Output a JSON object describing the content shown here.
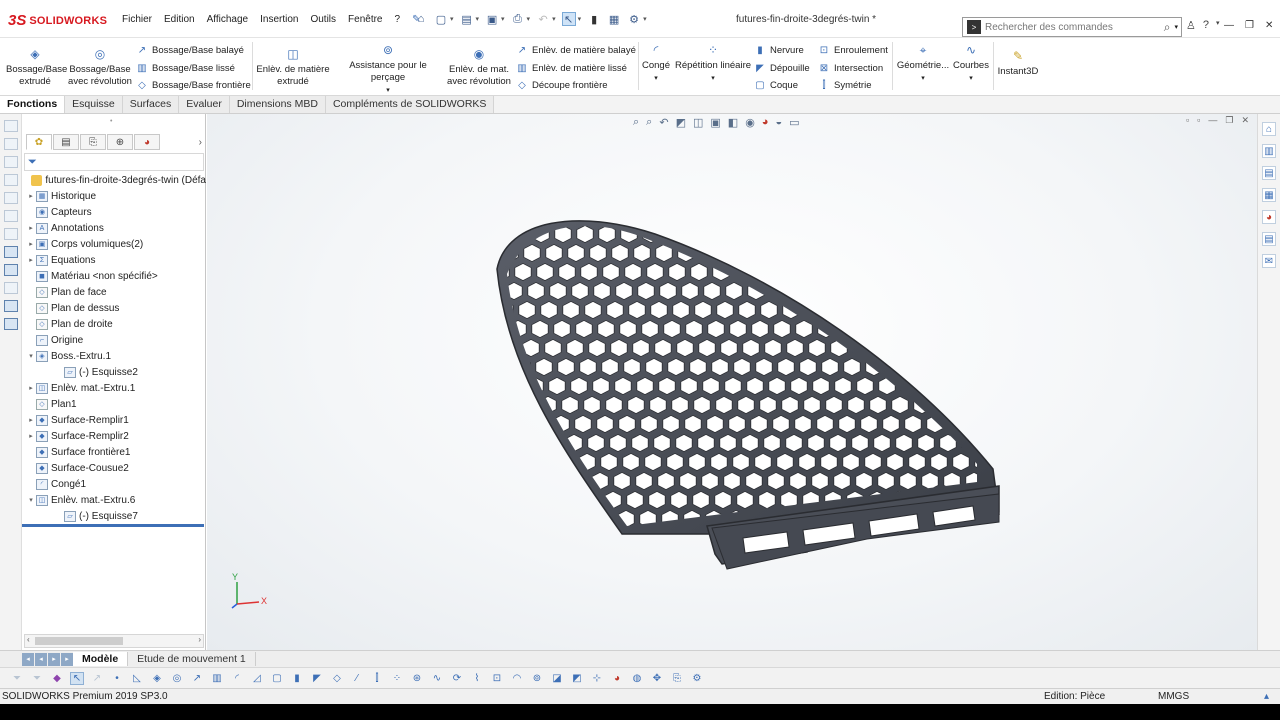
{
  "app": {
    "brand_ds": "3S",
    "brand_name": "SOLIDWORKS",
    "doc_title": "futures-fin-droite-3degrés-twin *",
    "search_placeholder": "Rechercher des commandes"
  },
  "menu": [
    "Fichier",
    "Edition",
    "Affichage",
    "Insertion",
    "Outils",
    "Fenêtre",
    "?"
  ],
  "ribbon": {
    "boss_extrude": [
      "Bossage/Base",
      "extrudé"
    ],
    "boss_revolve": [
      "Bossage/Base",
      "avec révolution"
    ],
    "boss_swept": "Bossage/Base balayé",
    "boss_loft": "Bossage/Base lissé",
    "boss_boundary": "Bossage/Base frontière",
    "cut_extrude": [
      "Enlèv. de matière",
      "extrudé"
    ],
    "hole_wizard": "Assistance pour le perçage",
    "cut_revolve": [
      "Enlèv. de mat.",
      "avec révolution"
    ],
    "cut_swept": "Enlèv. de matière balayé",
    "cut_loft": "Enlèv. de matière lissé",
    "cut_boundary": "Découpe frontière",
    "fillet": "Congé",
    "linear_pattern": "Répétition linéaire",
    "rib": "Nervure",
    "draft": "Dépouille",
    "shell": "Coque",
    "wrap": "Enroulement",
    "intersect": "Intersection",
    "mirror": "Symétrie",
    "ref_geometry": "Géométrie...",
    "curves": "Courbes",
    "instant3d": "Instant3D"
  },
  "tabs": [
    "Fonctions",
    "Esquisse",
    "Surfaces",
    "Evaluer",
    "Dimensions MBD",
    "Compléments de SOLIDWORKS"
  ],
  "tree": {
    "root": "futures-fin-droite-3degrés-twin  (Défa",
    "items": [
      {
        "label": "Historique",
        "expand": "▸",
        "indent": 1
      },
      {
        "label": "Capteurs",
        "expand": "",
        "indent": 1
      },
      {
        "label": "Annotations",
        "expand": "▸",
        "indent": 1
      },
      {
        "label": "Corps volumiques(2)",
        "expand": "▸",
        "indent": 1
      },
      {
        "label": "Equations",
        "expand": "▸",
        "indent": 1
      },
      {
        "label": "Matériau <non spécifié>",
        "expand": "",
        "indent": 1
      },
      {
        "label": "Plan de face",
        "expand": "",
        "indent": 1
      },
      {
        "label": "Plan de dessus",
        "expand": "",
        "indent": 1
      },
      {
        "label": "Plan de droite",
        "expand": "",
        "indent": 1
      },
      {
        "label": "Origine",
        "expand": "",
        "indent": 1
      },
      {
        "label": "Boss.-Extru.1",
        "expand": "▾",
        "indent": 1
      },
      {
        "label": "(-) Esquisse2",
        "expand": "",
        "indent": 2
      },
      {
        "label": "Enlèv. mat.-Extru.1",
        "expand": "▸",
        "indent": 1
      },
      {
        "label": "Plan1",
        "expand": "",
        "indent": 1
      },
      {
        "label": "Surface-Remplir1",
        "expand": "▸",
        "indent": 1
      },
      {
        "label": "Surface-Remplir2",
        "expand": "▸",
        "indent": 1
      },
      {
        "label": "Surface frontière1",
        "expand": "",
        "indent": 1
      },
      {
        "label": "Surface-Cousue2",
        "expand": "",
        "indent": 1
      },
      {
        "label": "Congé1",
        "expand": "",
        "indent": 1
      },
      {
        "label": "Enlèv. mat.-Extru.6",
        "expand": "▾",
        "indent": 1
      },
      {
        "label": "(-) Esquisse7",
        "expand": "",
        "indent": 2
      }
    ]
  },
  "bottom_tabs": [
    "Modèle",
    "Etude de mouvement 1"
  ],
  "status": {
    "product": "SOLIDWORKS Premium 2019 SP3.0",
    "mode": "Edition: Pièce",
    "units": "MMGS"
  },
  "triad": {
    "x": "X",
    "y": "Y"
  },
  "colors": {
    "part": "#4a4e57",
    "accent": "#3d6fb6",
    "rollback": "#3d6fb6"
  }
}
